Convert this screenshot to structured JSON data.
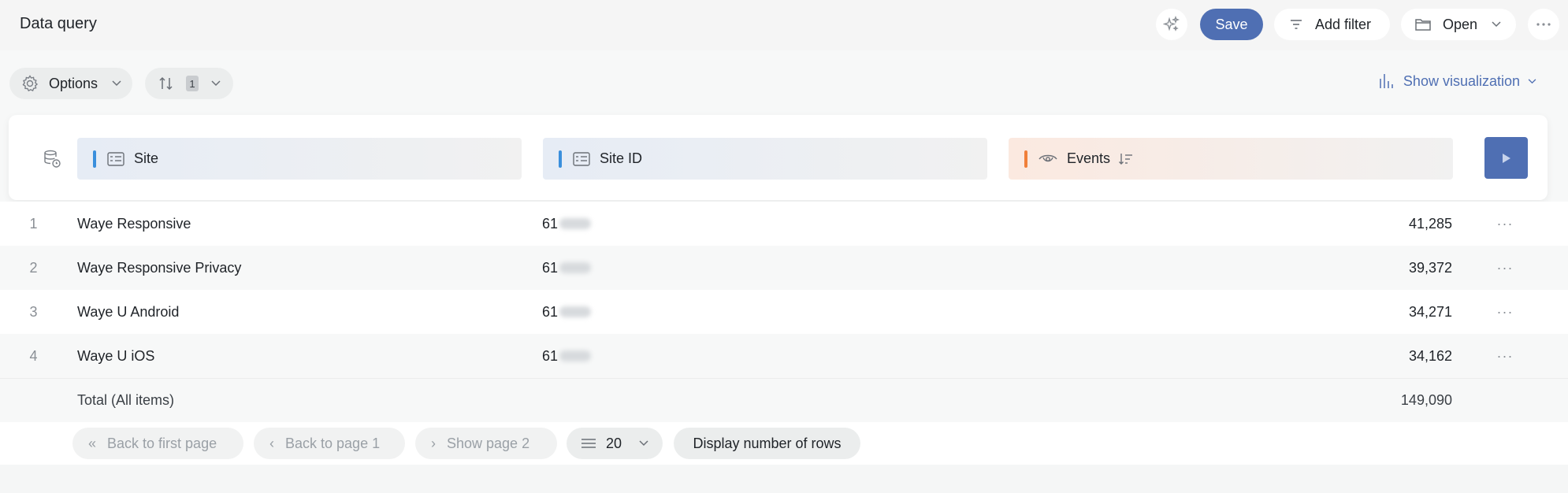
{
  "header": {
    "title": "Data query",
    "save_label": "Save",
    "add_filter_label": "Add filter",
    "open_label": "Open"
  },
  "toolbar": {
    "options_label": "Options",
    "sort_count": "1",
    "show_visualization_label": "Show visualization"
  },
  "columns": [
    {
      "label": "Site",
      "accent": "#3a8fdc"
    },
    {
      "label": "Site ID",
      "accent": "#3a8fdc"
    },
    {
      "label": "Events",
      "accent": "#f07f3a"
    }
  ],
  "rows": [
    {
      "index": "1",
      "site": "Waye Responsive",
      "site_id_prefix": "61",
      "events": "41,285"
    },
    {
      "index": "2",
      "site": "Waye Responsive Privacy",
      "site_id_prefix": "61",
      "events": "39,372"
    },
    {
      "index": "3",
      "site": "Waye U Android",
      "site_id_prefix": "61",
      "events": "34,271"
    },
    {
      "index": "4",
      "site": "Waye U iOS",
      "site_id_prefix": "61",
      "events": "34,162"
    }
  ],
  "total": {
    "label": "Total (All items)",
    "events": "149,090"
  },
  "pager": {
    "first_page_label": "Back to first page",
    "prev_page_label": "Back to page 1",
    "next_page_label": "Show page 2",
    "rows_per_page": "20",
    "display_rows_label": "Display number of rows"
  },
  "colors": {
    "accent": "#4f6fb3",
    "site_col": "#3a8fdc",
    "events_col": "#f07f3a"
  }
}
